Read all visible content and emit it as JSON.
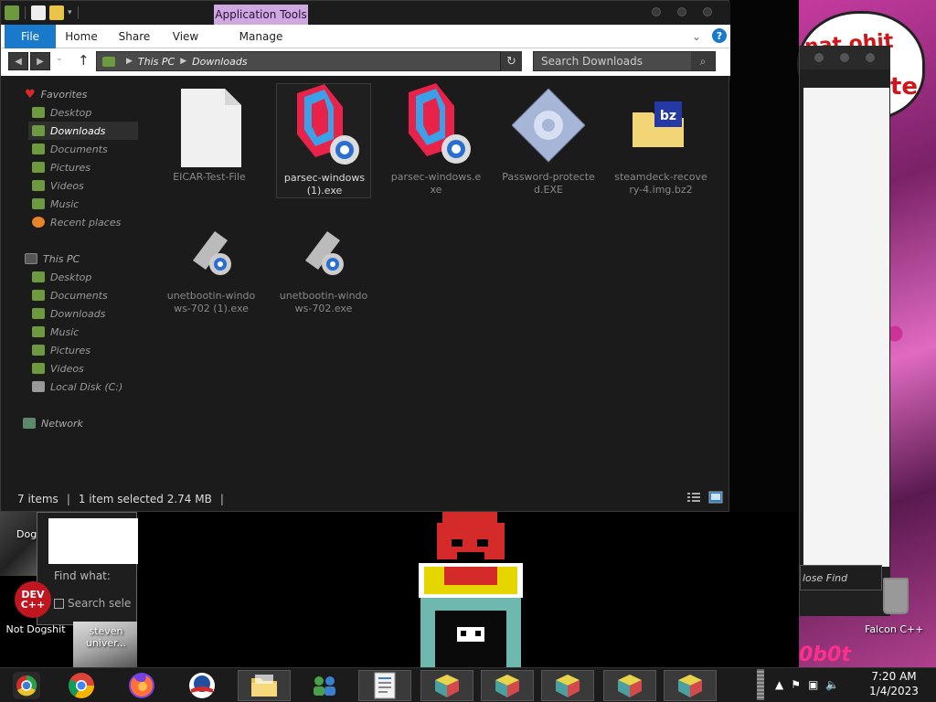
{
  "window": {
    "context_tab": "Application Tools",
    "ribbon_tabs": [
      "File",
      "Home",
      "Share",
      "View",
      "Manage"
    ]
  },
  "address": {
    "crumbs": [
      "This PC",
      "Downloads"
    ]
  },
  "search": {
    "placeholder": "Search Downloads"
  },
  "nav": {
    "favorites_label": "Favorites",
    "favorites": [
      "Desktop",
      "Downloads",
      "Documents",
      "Pictures",
      "Videos",
      "Music",
      "Recent places"
    ],
    "thispc_label": "This PC",
    "thispc": [
      "Desktop",
      "Documents",
      "Downloads",
      "Music",
      "Pictures",
      "Videos",
      "Local Disk (C:)"
    ],
    "network_label": "Network"
  },
  "files": [
    {
      "name": "EICAR-Test-File",
      "icon": "blank-file-icon"
    },
    {
      "name": "parsec-windows (1).exe",
      "icon": "parsec-icon",
      "selected": true
    },
    {
      "name": "parsec-windows.exe",
      "icon": "parsec-icon"
    },
    {
      "name": "Password-protected.EXE",
      "icon": "generic-exe-icon"
    },
    {
      "name": "steamdeck-recovery-4.img.bz2",
      "icon": "bz2-archive-icon"
    },
    {
      "name": "unetbootin-windows-702 (1).exe",
      "icon": "unetbootin-icon"
    },
    {
      "name": "unetbootin-windows-702.exe",
      "icon": "unetbootin-icon"
    }
  ],
  "status": {
    "items": "7 items",
    "selected": "1 item selected  2.74 MB"
  },
  "desktop": {
    "balloon_line1": "nat ohit",
    "balloon_line2": "te",
    "ribbon_text": "0b0t",
    "close_find": "lose Find",
    "find_what": "Find what:",
    "search_sel": "Search sele",
    "dev_icon_text": "DEV C++",
    "label_not_dogshit": "Not Dogshit",
    "label_dog": "Dog",
    "label_steven": "steven univer...",
    "label_falcon": "Falcon C++"
  },
  "taskbar": {
    "time": "7:20 AM",
    "date": "1/4/2023"
  }
}
